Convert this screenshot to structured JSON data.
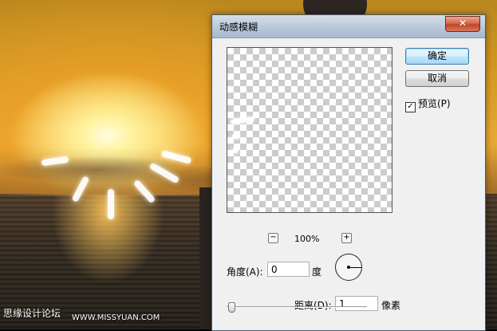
{
  "dialog": {
    "title": "动感模糊",
    "close_label": "✕",
    "ok_label": "确定",
    "cancel_label": "取消",
    "preview_checkbox": {
      "label": "预览(P)",
      "checked": true
    },
    "zoom": {
      "minus_label": "−",
      "level": "100%",
      "plus_label": "+"
    },
    "angle": {
      "label": "角度(A):",
      "value": "0",
      "unit": "度"
    },
    "distance": {
      "label": "距离(D):",
      "value": "1",
      "unit": "像素"
    }
  },
  "background": {
    "watermark_left": "思缘设计论坛",
    "watermark_right": "WWW.MISSYUAN.COM"
  }
}
